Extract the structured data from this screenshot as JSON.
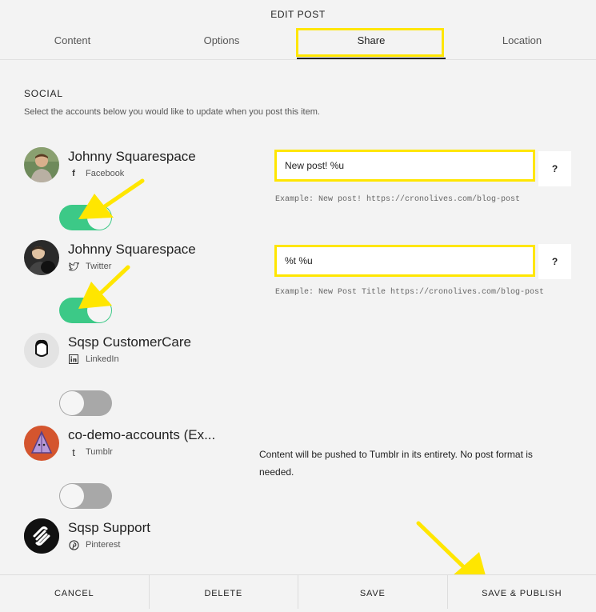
{
  "header": {
    "title": "EDIT POST"
  },
  "tabs": [
    {
      "label": "Content"
    },
    {
      "label": "Options"
    },
    {
      "label": "Share"
    },
    {
      "label": "Location"
    }
  ],
  "active_tab": "Share",
  "social": {
    "title": "SOCIAL",
    "description": "Select the accounts below you would like to update when you post this item."
  },
  "accounts": [
    {
      "name": "Johnny Squarespace",
      "network": "Facebook",
      "enabled": true,
      "template": "New post! %u",
      "example": "Example: New post! https://cronolives.com/blog-post"
    },
    {
      "name": "Johnny Squarespace",
      "network": "Twitter",
      "enabled": true,
      "template": "%t %u",
      "example": "Example: New Post Title https://cronolives.com/blog-post"
    },
    {
      "name": "Sqsp CustomerCare",
      "network": "LinkedIn",
      "enabled": false
    },
    {
      "name": "co-demo-accounts (Ex...",
      "network": "Tumblr",
      "enabled": false,
      "note": "Content will be pushed to Tumblr in its entirety. No post format is needed."
    },
    {
      "name": "Sqsp Support",
      "network": "Pinterest"
    }
  ],
  "help_label": "?",
  "footer": {
    "cancel": "CANCEL",
    "delete": "DELETE",
    "save": "SAVE",
    "save_publish": "SAVE & PUBLISH"
  },
  "colors": {
    "toggle_on": "#3cc987",
    "toggle_off": "#a8a8a8",
    "highlight": "#ffe600"
  }
}
